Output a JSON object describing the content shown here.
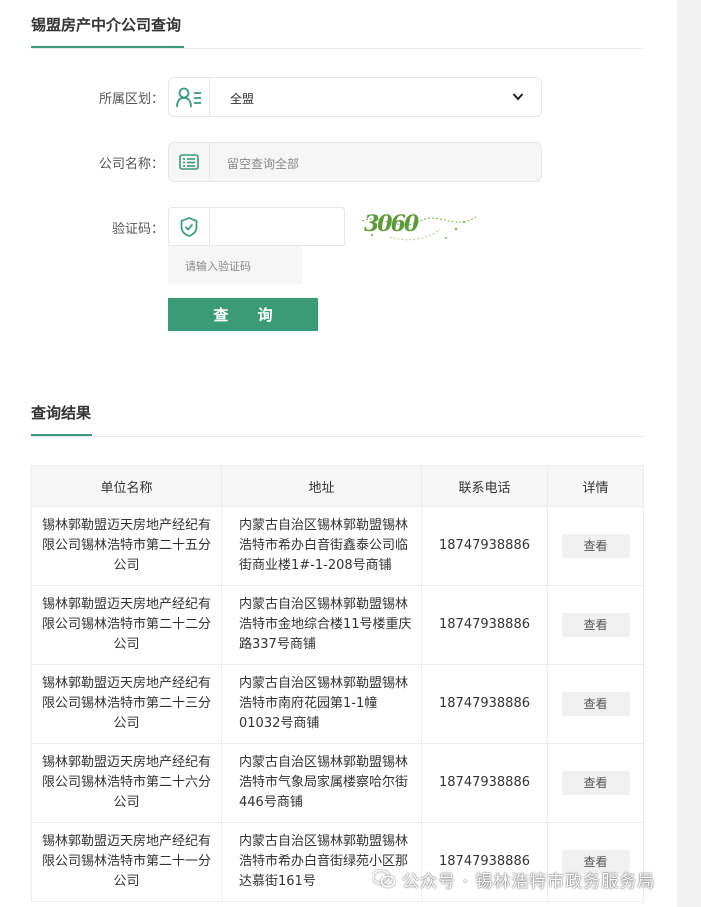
{
  "search": {
    "title": "锡盟房产中介公司查询",
    "district_label": "所属区划：",
    "district_value": "全盟",
    "company_label": "公司名称：",
    "company_placeholder": "留空查询全部",
    "captcha_label": "验证码：",
    "captcha_placeholder": "请输入验证码",
    "captcha_text": "3060",
    "query_button": "查 询"
  },
  "results": {
    "title": "查询结果",
    "columns": [
      "单位名称",
      "地址",
      "联系电话",
      "详情"
    ],
    "rows": [
      {
        "name": "锡林郭勒盟迈天房地产经纪有限公司锡林浩特市第二十五分公司",
        "address": "内蒙古自治区锡林郭勒盟锡林浩特市希办白音街鑫泰公司临街商业楼1#-1-208号商铺",
        "phone": "18747938886",
        "detail": "查看"
      },
      {
        "name": "锡林郭勒盟迈天房地产经纪有限公司锡林浩特市第二十二分公司",
        "address": "内蒙古自治区锡林郭勒盟锡林浩特市金地综合楼11号楼重庆路337号商铺",
        "phone": "18747938886",
        "detail": "查看"
      },
      {
        "name": "锡林郭勒盟迈天房地产经纪有限公司锡林浩特市第二十三分公司",
        "address": "内蒙古自治区锡林郭勒盟锡林浩特市南府花园第1-1幢01032号商铺",
        "phone": "18747938886",
        "detail": "查看"
      },
      {
        "name": "锡林郭勒盟迈天房地产经纪有限公司锡林浩特市第二十六分公司",
        "address": "内蒙古自治区锡林郭勒盟锡林浩特市气象局家属楼察哈尔街446号商铺",
        "phone": "18747938886",
        "detail": "查看"
      },
      {
        "name": "锡林郭勒盟迈天房地产经纪有限公司锡林浩特市第二十一分公司",
        "address": "内蒙古自治区锡林郭勒盟锡林浩特市希办白音街绿苑小区那达慕街161号",
        "phone": "18747938886",
        "detail": "查看"
      }
    ]
  },
  "watermark": {
    "text": "公众号 · 锡林浩特市政务服务局"
  },
  "colors": {
    "accent": "#3a9b77"
  }
}
